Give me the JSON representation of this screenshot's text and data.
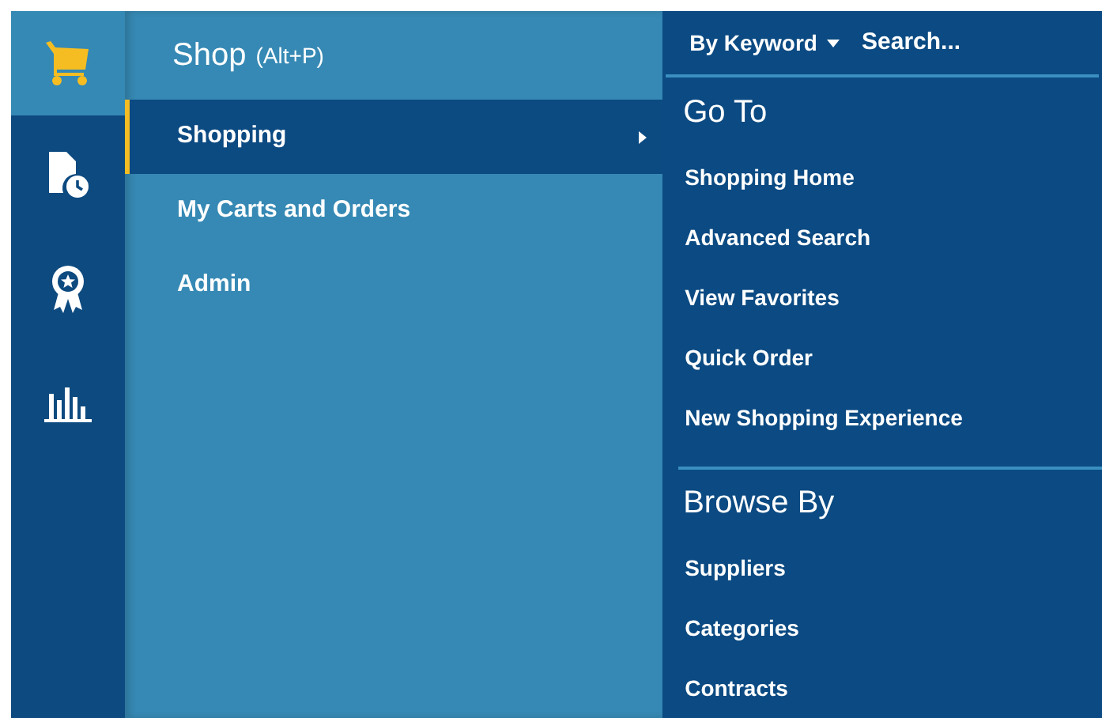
{
  "rail": {
    "items": [
      {
        "kind": "cart",
        "selected": true
      },
      {
        "kind": "document-clock",
        "selected": false
      },
      {
        "kind": "award",
        "selected": false
      },
      {
        "kind": "chart",
        "selected": false
      }
    ]
  },
  "menu": {
    "title": "Shop",
    "shortcut": "(Alt+P)",
    "items": [
      {
        "label": "Shopping",
        "selected": true,
        "has_submenu": true
      },
      {
        "label": "My Carts and Orders",
        "selected": false,
        "has_submenu": false
      },
      {
        "label": "Admin",
        "selected": false,
        "has_submenu": false
      }
    ]
  },
  "search": {
    "scope": "By Keyword",
    "placeholder": "Search..."
  },
  "sections": [
    {
      "heading": "Go To",
      "links": [
        "Shopping Home",
        "Advanced Search",
        "View Favorites",
        "Quick Order",
        "New Shopping Experience"
      ]
    },
    {
      "heading": "Browse By",
      "links": [
        "Suppliers",
        "Categories",
        "Contracts"
      ]
    }
  ]
}
